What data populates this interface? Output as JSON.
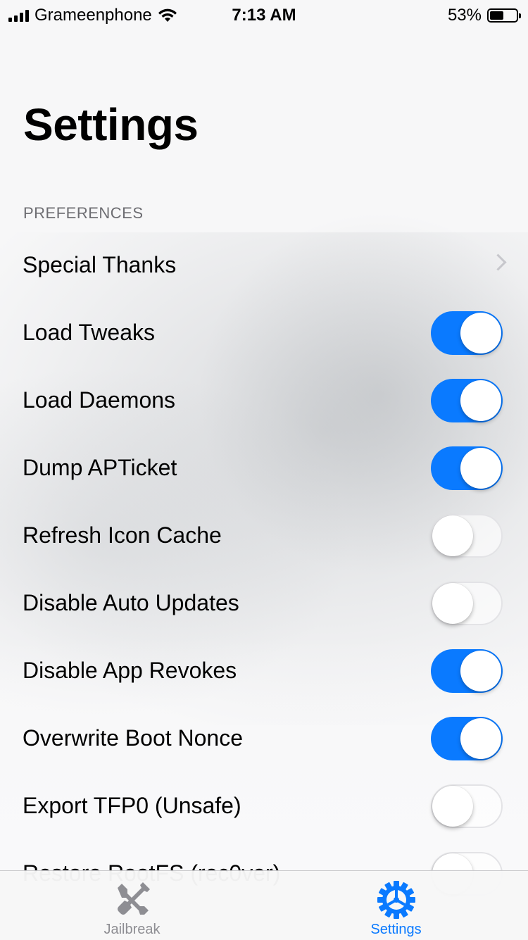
{
  "status_bar": {
    "carrier": "Grameenphone",
    "time": "7:13 AM",
    "battery_percent": "53%",
    "battery_level": 0.53,
    "icons": [
      "signal-icon",
      "wifi-icon",
      "battery-icon"
    ]
  },
  "page": {
    "title": "Settings",
    "section_header": "PREFERENCES"
  },
  "rows": [
    {
      "label": "Special Thanks",
      "type": "disclosure"
    },
    {
      "label": "Load Tweaks",
      "type": "toggle",
      "on": true
    },
    {
      "label": "Load Daemons",
      "type": "toggle",
      "on": true
    },
    {
      "label": "Dump APTicket",
      "type": "toggle",
      "on": true
    },
    {
      "label": "Refresh Icon Cache",
      "type": "toggle",
      "on": false
    },
    {
      "label": "Disable Auto Updates",
      "type": "toggle",
      "on": false
    },
    {
      "label": "Disable App Revokes",
      "type": "toggle",
      "on": true
    },
    {
      "label": "Overwrite Boot Nonce",
      "type": "toggle",
      "on": true
    },
    {
      "label": "Export TFP0 (Unsafe)",
      "type": "toggle",
      "on": false
    },
    {
      "label": "Restore RootFS (rec0ver)",
      "type": "toggle",
      "on": false
    }
  ],
  "tab_bar": {
    "tabs": [
      {
        "label": "Jailbreak",
        "icon": "tools-icon",
        "active": false
      },
      {
        "label": "Settings",
        "icon": "gear-icon",
        "active": true
      }
    ]
  },
  "colors": {
    "accent": "#0a7aff",
    "inactive_tab": "#8e8e93",
    "section_header": "#6d6d72",
    "chevron": "#c7c7cc"
  }
}
